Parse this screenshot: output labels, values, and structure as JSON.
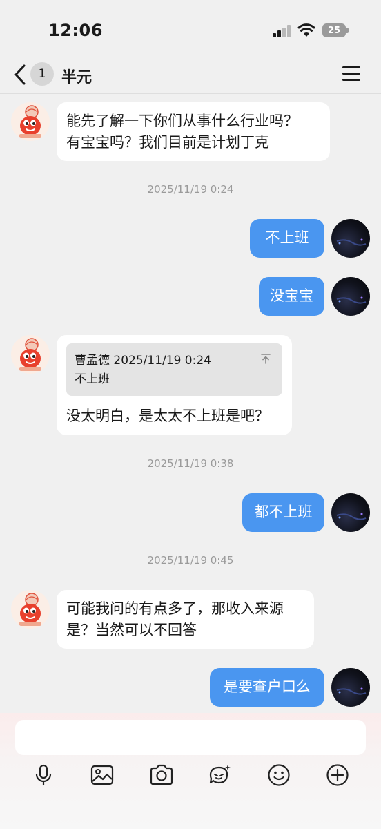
{
  "status_bar": {
    "time": "12:06",
    "battery": "25"
  },
  "header": {
    "unread_count": "1",
    "title": "半元"
  },
  "messages": [
    {
      "line1": "能先了解一下你们从事什么行业吗？",
      "line2": "有宝宝吗？我们目前是计划丁克"
    },
    {
      "timestamp": "2025/11/19 0:24"
    },
    {
      "text": "不上班"
    },
    {
      "text": "没宝宝"
    },
    {
      "quote_header": "曹孟德 2025/11/19 0:24",
      "quote_text": "不上班",
      "text": "没太明白，是太太不上班是吧？"
    },
    {
      "timestamp": "2025/11/19 0:38"
    },
    {
      "text": "都不上班"
    },
    {
      "timestamp": "2025/11/19 0:45"
    },
    {
      "line1": "可能我问的有点多了，那收入来源",
      "line2": "是？当然可以不回答"
    },
    {
      "text": "是要查户口么"
    }
  ],
  "input": {
    "placeholder": ""
  },
  "toolbar": [
    "microphone-icon",
    "image-icon",
    "camera-icon",
    "sticker-icon",
    "emoji-icon",
    "plus-icon"
  ],
  "colors": {
    "outgoing_bubble": "#4a96f0",
    "incoming_bubble": "#ffffff",
    "background": "#f0f0f0"
  }
}
